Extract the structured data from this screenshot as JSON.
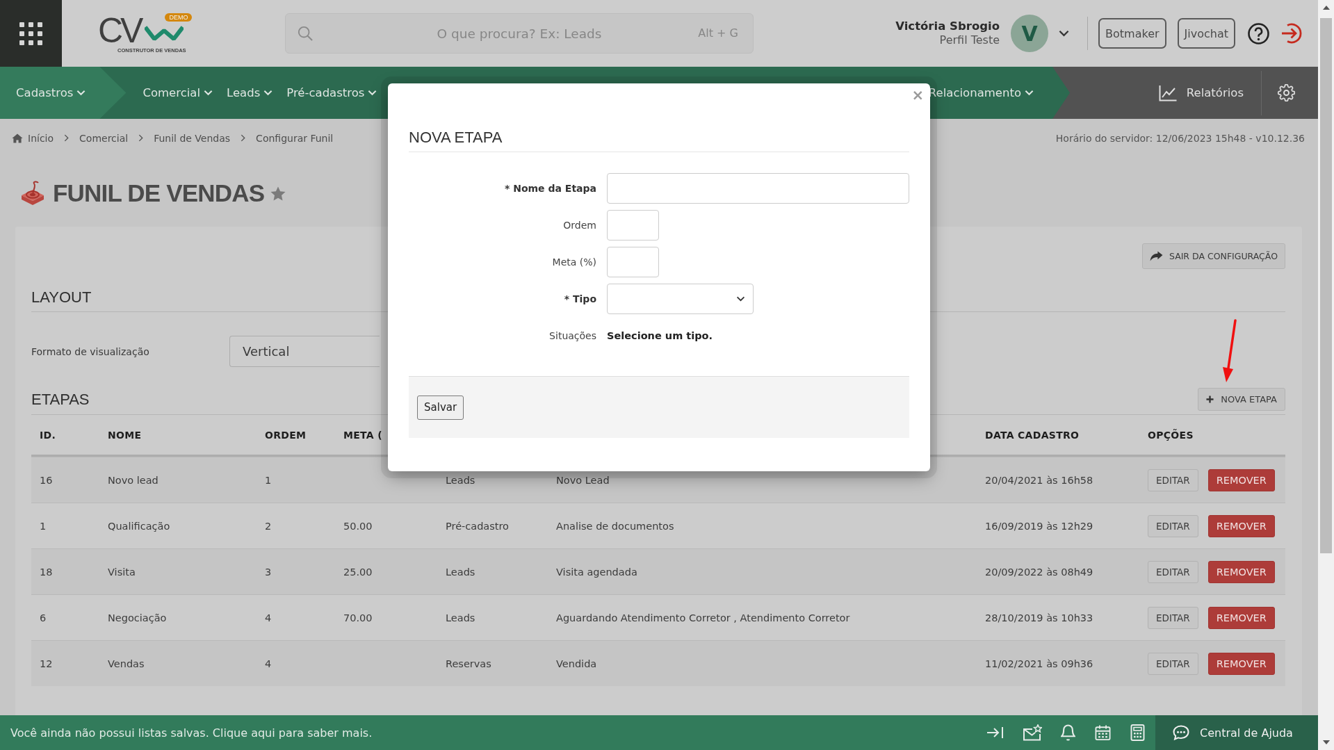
{
  "header": {
    "logo": {
      "mark": "CV",
      "badge": "DEMO",
      "tagline": "CONSTRUTOR DE VENDAS"
    },
    "search": {
      "placeholder": "O que procura? Ex: Leads",
      "shortcut": "Alt + G"
    },
    "user": {
      "name": "Victória Sbrogio",
      "profile": "Perfil Teste",
      "initial": "V"
    },
    "buttons": [
      "Botmaker",
      "Jivochat"
    ]
  },
  "nav": {
    "items": [
      {
        "label": "Cadastros",
        "selected": true
      },
      {
        "label": "Comercial",
        "selected": false
      },
      {
        "label": "Leads",
        "selected": false
      },
      {
        "label": "Pré-cadastros",
        "selected": false
      },
      {
        "label": "Relacionamento",
        "selected": false
      }
    ],
    "reports": "Relatórios"
  },
  "breadcrumb": {
    "items": [
      "Início",
      "Comercial",
      "Funil de Vendas",
      "Configurar Funil"
    ],
    "server_time": "Horário do servidor: 12/06/2023 15h48 - v10.12.36"
  },
  "page": {
    "title": "FUNIL DE VENDAS",
    "favorite": false,
    "exit_button": "SAIR DA CONFIGURAÇÃO"
  },
  "layout_section": {
    "title": "LAYOUT",
    "field_label": "Formato de visualização",
    "value": "Vertical"
  },
  "stages": {
    "title": "ETAPAS",
    "add_button": "NOVA ETAPA",
    "columns": [
      "ID.",
      "NOME",
      "ORDEM",
      "META (",
      "DATA CADASTRO",
      "OPÇÕES"
    ],
    "rows": [
      {
        "id": "16",
        "name": "Novo lead",
        "order": "1",
        "type": "Leads",
        "situations": "Novo Lead",
        "date": "20/04/2021 às 16h58",
        "actions": [
          {
            "label": "EDITAR",
            "kind": "default"
          },
          {
            "label": "REMOVER",
            "kind": "danger"
          }
        ]
      },
      {
        "id": "1",
        "name": "Qualificação",
        "order": "2",
        "goal": "50.00",
        "type": "Pré-cadastro",
        "situations": "Analise de documentos",
        "date": "16/09/2019 às 12h29",
        "actions": [
          {
            "label": "EDITAR",
            "kind": "default"
          },
          {
            "label": "REMOVER",
            "kind": "danger"
          }
        ]
      },
      {
        "id": "18",
        "name": "Visita",
        "order": "3",
        "goal": "25.00",
        "type": "Leads",
        "situations": "Visita agendada",
        "date": "20/09/2022 às 08h49",
        "actions": [
          {
            "label": "EDITAR",
            "kind": "default"
          },
          {
            "label": "REMOVER",
            "kind": "danger"
          }
        ]
      },
      {
        "id": "6",
        "name": "Negociação",
        "order": "4",
        "goal": "70.00",
        "type": "Leads",
        "situations": "Aguardando Atendimento Corretor , Atendimento Corretor",
        "date": "28/10/2019 às 10h33",
        "actions": [
          {
            "label": "EDITAR",
            "kind": "default"
          },
          {
            "label": "REMOVER",
            "kind": "danger"
          }
        ]
      },
      {
        "id": "12",
        "name": "Vendas",
        "order": "4",
        "type": "Reservas",
        "situations": "Vendida",
        "date": "11/02/2021 às 09h36",
        "actions": [
          {
            "label": "EDITAR",
            "kind": "default"
          },
          {
            "label": "REMOVER",
            "kind": "danger"
          }
        ]
      }
    ]
  },
  "modal": {
    "close": "×",
    "title": "NOVA ETAPA",
    "fields": [
      {
        "kind": "text",
        "label": "* Nome da Etapa",
        "required": true
      },
      {
        "kind": "short",
        "label": "Ordem",
        "required": false
      },
      {
        "kind": "short",
        "label": "Meta (%)",
        "required": false
      },
      {
        "kind": "select",
        "label": "* Tipo",
        "required": true
      },
      {
        "kind": "info",
        "label": "Situações",
        "value": "Selecione um tipo.",
        "required": false
      }
    ],
    "save_button": "Salvar"
  },
  "footer": {
    "message": "Você ainda não possui listas salvas. Clique aqui para saber mais.",
    "help": "Central de Ajuda"
  }
}
